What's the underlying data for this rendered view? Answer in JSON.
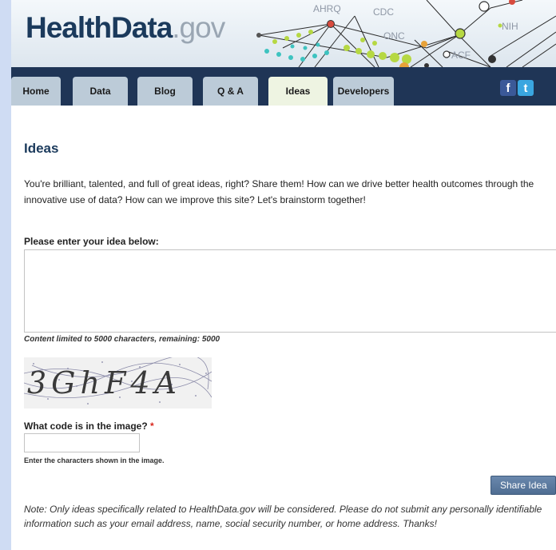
{
  "header": {
    "logo_main": "HealthData",
    "logo_tld": ".gov",
    "agencies": [
      "AHRQ",
      "CDC",
      "ONC",
      "NIH",
      "ACF"
    ]
  },
  "nav": {
    "tabs": [
      {
        "label": "Home"
      },
      {
        "label": "Data"
      },
      {
        "label": "Blog"
      },
      {
        "label": "Q & A"
      },
      {
        "label": "Ideas",
        "active": true
      },
      {
        "label": "Developers"
      }
    ],
    "social": {
      "facebook_glyph": "f",
      "twitter_glyph": "t"
    }
  },
  "content": {
    "title": "Ideas",
    "intro": "You're brilliant, talented, and full of great ideas, right? Share them! How can we drive better health outcomes through the innovative use of data? How can we improve this site? Let's brainstorm together!",
    "idea_label": "Please enter your idea below:",
    "idea_value": "",
    "char_limit": "Content limited to 5000 characters, remaining: 5000",
    "captcha_code": "3GhF4A",
    "code_label": "What code is in the image?",
    "required_mark": "*",
    "code_value": "",
    "code_help": "Enter the characters shown in the image.",
    "share_button": "Share Idea",
    "note": "Note: Only ideas specifically related to HealthData.gov will be considered. Please do not submit any personally identifiable information such as your email address, name, social security number, or home address. Thanks!"
  },
  "colors": {
    "nav_bg": "#1f3556",
    "title": "#1b3a5c",
    "tab_bg": "#bccbd8",
    "active_tab_bg": "#eef4e2",
    "button": "#5a78a0",
    "page_bg": "#cfdcf3"
  }
}
